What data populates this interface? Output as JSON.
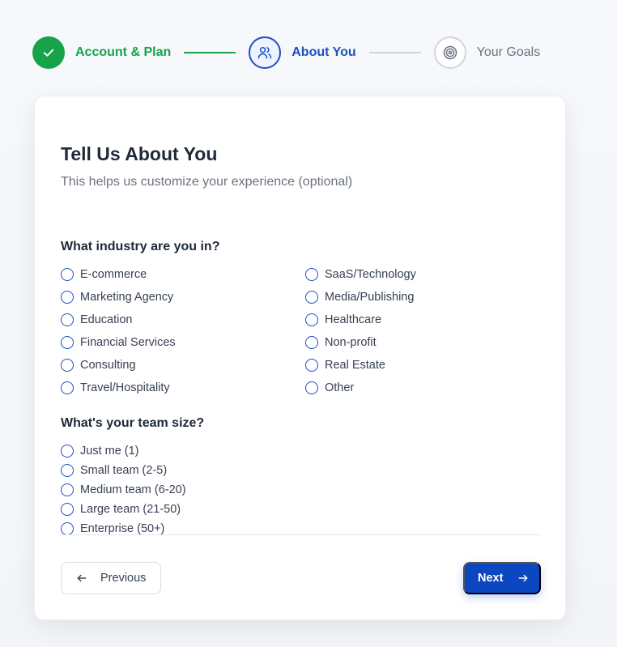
{
  "stepper": {
    "steps": [
      {
        "label": "Account & Plan",
        "state": "done",
        "icon": "check-icon"
      },
      {
        "label": "About You",
        "state": "active",
        "icon": "users-icon"
      },
      {
        "label": "Your Goals",
        "state": "todo",
        "icon": "target-icon"
      }
    ]
  },
  "card": {
    "title": "Tell Us About You",
    "subtitle": "This helps us customize your experience (optional)"
  },
  "industry": {
    "question": "What industry are you in?",
    "options": [
      "E-commerce",
      "SaaS/Technology",
      "Marketing Agency",
      "Media/Publishing",
      "Education",
      "Healthcare",
      "Financial Services",
      "Non-profit",
      "Consulting",
      "Real Estate",
      "Travel/Hospitality",
      "Other"
    ]
  },
  "team_size": {
    "question": "What's your team size?",
    "options": [
      "Just me (1)",
      "Small team (2-5)",
      "Medium team (6-20)",
      "Large team (21-50)",
      "Enterprise (50+)"
    ]
  },
  "buttons": {
    "previous_label": "Previous",
    "previous_icon": "arrow-left-icon",
    "next_label": "Next",
    "next_icon": "arrow-right-icon"
  },
  "colors": {
    "done": "#16a34a",
    "accent": "#1d4fbf",
    "primary_button": "#0b47c1",
    "muted": "#6b7280"
  }
}
